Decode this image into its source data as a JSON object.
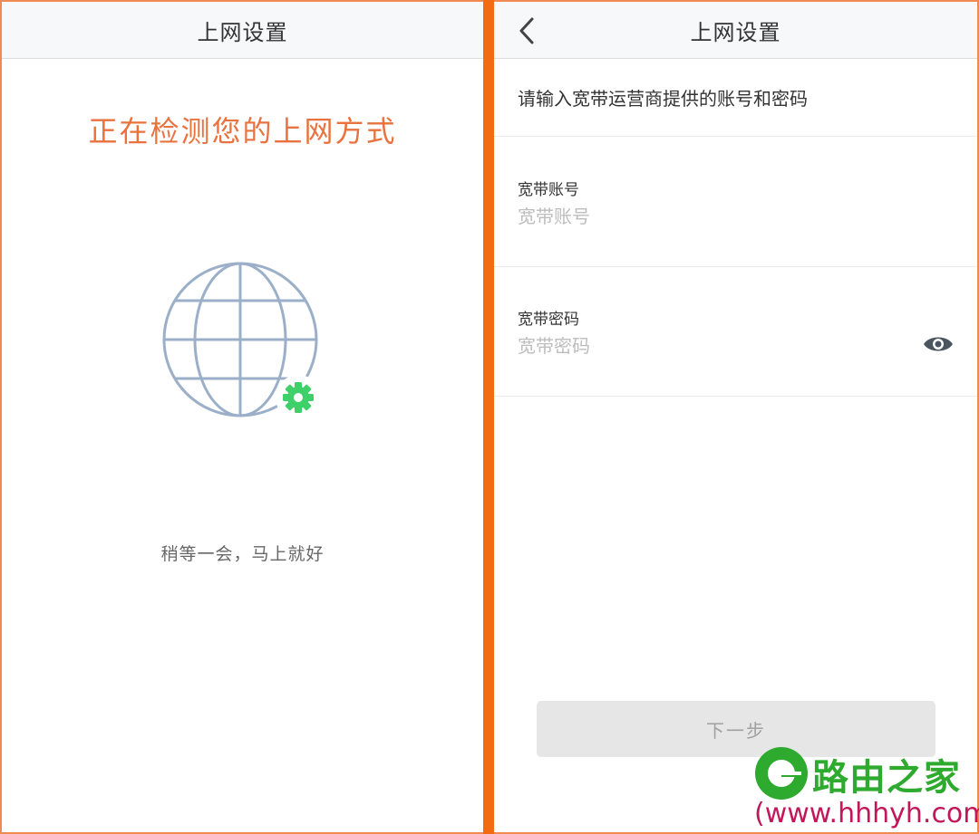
{
  "left_screen": {
    "header": {
      "title": "上网设置"
    },
    "detect_title": "正在检测您的上网方式",
    "globe": {
      "icon": "globe-icon",
      "badge_icon": "gear-icon",
      "badge_color": "#3ed16a"
    },
    "wait_text": "稍等一会，马上就好"
  },
  "right_screen": {
    "header": {
      "title": "上网设置",
      "back_icon": "chevron-left-icon"
    },
    "instruction": "请输入宽带运营商提供的账号和密码",
    "account_field": {
      "label": "宽带账号",
      "placeholder": "宽带账号",
      "value": ""
    },
    "password_field": {
      "label": "宽带密码",
      "placeholder": "宽带密码",
      "value": "",
      "toggle_icon": "eye-icon"
    },
    "next_button": {
      "label": "下一步",
      "enabled": false
    }
  },
  "watermark": {
    "name": "路由之家",
    "url": "(www.hhhyh.com)"
  },
  "colors": {
    "accent": "#e8733f",
    "divider": "#f26a12",
    "globe_stroke": "#9bb0c8",
    "gear": "#3ed16a"
  }
}
